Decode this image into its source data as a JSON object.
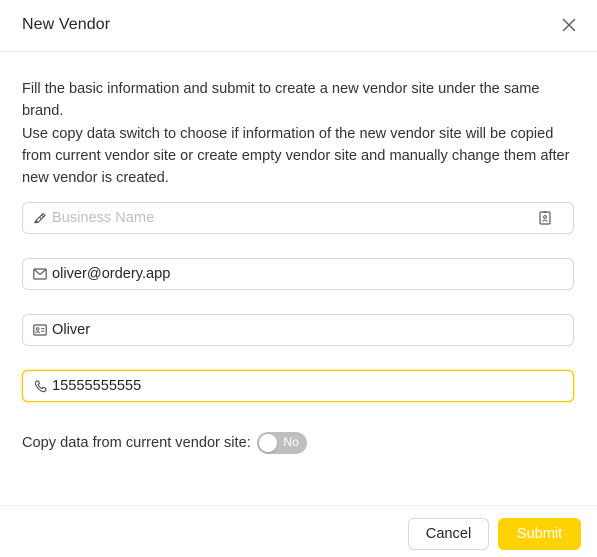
{
  "dialog": {
    "title": "New Vendor",
    "close_icon": "close-icon"
  },
  "description": {
    "line1": "Fill the basic information and submit to create a new vendor site under the same brand.",
    "line2": "Use copy data switch to choose if information of the new vendor site will be copied from current vendor site or create empty vendor site and manually change them after new vendor is created."
  },
  "form": {
    "business_name": {
      "value": "",
      "placeholder": "Business Name",
      "prefix_icon": "highlighter-icon",
      "suffix_icon": "id-badge-icon"
    },
    "email": {
      "value": "oliver@ordery.app",
      "prefix_icon": "mail-icon"
    },
    "contact_name": {
      "value": "Oliver",
      "prefix_icon": "id-card-icon"
    },
    "phone": {
      "value": "15555555555",
      "prefix_icon": "phone-icon",
      "focused": true
    },
    "copy_data": {
      "label": "Copy data from current vendor site",
      "separator": ":",
      "state_text": "No",
      "checked": false
    }
  },
  "footer": {
    "cancel_label": "Cancel",
    "submit_label": "Submit"
  },
  "colors": {
    "accent": "#ffd200",
    "focus_border": "#f2c500",
    "switch_off": "#bfbfbf",
    "border": "#d9d9d9",
    "text": "#262626",
    "placeholder": "#bfbfbf"
  }
}
